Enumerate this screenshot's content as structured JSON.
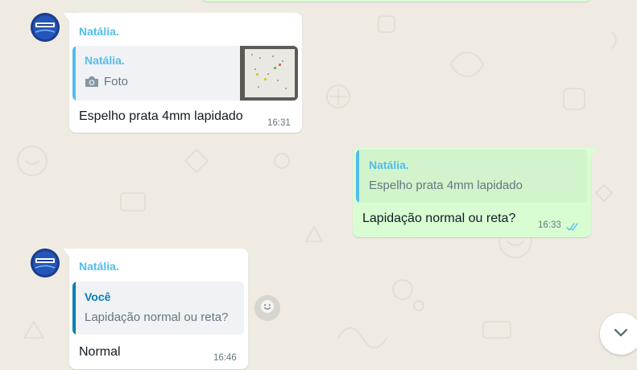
{
  "chat": {
    "messages": [
      {
        "direction": "incoming",
        "sender": "Natália.",
        "quoted": {
          "author": "Natália.",
          "text": "Foto",
          "icon": "camera-icon",
          "has_thumbnail": true
        },
        "text": "Espelho prata 4mm lapidado",
        "time": "16:31"
      },
      {
        "direction": "outgoing",
        "quoted": {
          "author": "Natália.",
          "text": "Espelho prata 4mm lapidado"
        },
        "text": "Lapidação normal ou reta?",
        "time": "16:33",
        "status": "read"
      },
      {
        "direction": "incoming",
        "sender": "Natália.",
        "quoted": {
          "author": "Você",
          "text": "Lapidação normal ou reta?"
        },
        "text": "Normal",
        "time": "16:46"
      }
    ]
  },
  "icons": {
    "read_receipt": "double-check-icon",
    "reaction": "smiley-icon",
    "scroll_down": "chevron-down-icon"
  },
  "colors": {
    "background": "#efeae2",
    "incoming_bubble": "#ffffff",
    "outgoing_bubble": "#d9fdd3",
    "sender_name": "#53bdeb",
    "quote_you": "#027eb5",
    "read_check": "#53bdeb"
  }
}
